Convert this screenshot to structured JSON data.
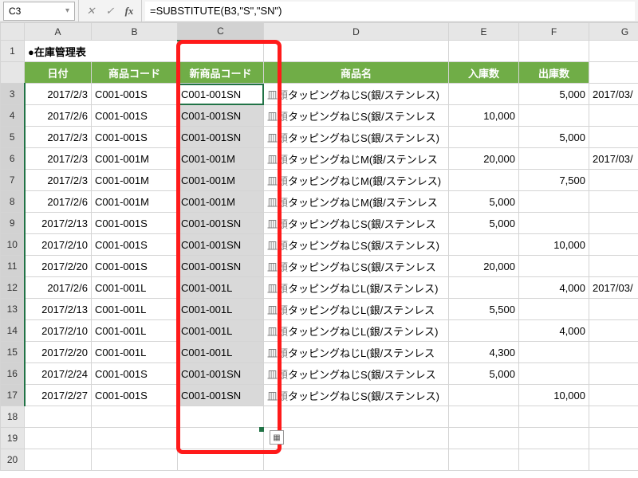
{
  "nameBox": "C3",
  "formula": "=SUBSTITUTE(B3,\"S\",\"SN\")",
  "columns": [
    "A",
    "B",
    "C",
    "D",
    "E",
    "F",
    "G"
  ],
  "selectedColumn": "C",
  "title": "●在庫管理表",
  "headers": {
    "A": "日付",
    "B": "商品コード",
    "C": "新商品コード",
    "D": "商品名",
    "E": "入庫数",
    "F": "出庫数"
  },
  "rows": [
    {
      "n": 3,
      "A": "2017/2/3",
      "B": "C001-001S",
      "C": "C001-001SN",
      "Dp": "皿頭",
      "D": "タッピングねじS(銀/ステンレス)",
      "E": "",
      "F": "5,000",
      "G": "2017/03/"
    },
    {
      "n": 4,
      "A": "2017/2/6",
      "B": "C001-001S",
      "C": "C001-001SN",
      "Dp": "皿頭",
      "D": "タッピングねじS(銀/ステンレス",
      "E": "10,000",
      "F": "",
      "G": ""
    },
    {
      "n": 5,
      "A": "2017/2/3",
      "B": "C001-001S",
      "C": "C001-001SN",
      "Dp": "皿頭",
      "D": "タッピングねじS(銀/ステンレス)",
      "E": "",
      "F": "5,000",
      "G": ""
    },
    {
      "n": 6,
      "A": "2017/2/3",
      "B": "C001-001M",
      "C": "C001-001M",
      "Dp": "皿頭",
      "D": "タッピングねじM(銀/ステンレス",
      "E": "20,000",
      "F": "",
      "G": "2017/03/"
    },
    {
      "n": 7,
      "A": "2017/2/3",
      "B": "C001-001M",
      "C": "C001-001M",
      "Dp": "皿頭",
      "D": "タッピングねじM(銀/ステンレス)",
      "E": "",
      "F": "7,500",
      "G": ""
    },
    {
      "n": 8,
      "A": "2017/2/6",
      "B": "C001-001M",
      "C": "C001-001M",
      "Dp": "皿頭",
      "D": "タッピングねじM(銀/ステンレス",
      "E": "5,000",
      "F": "",
      "G": ""
    },
    {
      "n": 9,
      "A": "2017/2/13",
      "B": "C001-001S",
      "C": "C001-001SN",
      "Dp": "皿頭",
      "D": "タッピングねじS(銀/ステンレス",
      "E": "5,000",
      "F": "",
      "G": ""
    },
    {
      "n": 10,
      "A": "2017/2/10",
      "B": "C001-001S",
      "C": "C001-001SN",
      "Dp": "皿頭",
      "D": "タッピングねじS(銀/ステンレス)",
      "E": "",
      "F": "10,000",
      "G": ""
    },
    {
      "n": 11,
      "A": "2017/2/20",
      "B": "C001-001S",
      "C": "C001-001SN",
      "Dp": "皿頭",
      "D": "タッピングねじS(銀/ステンレス",
      "E": "20,000",
      "F": "",
      "G": ""
    },
    {
      "n": 12,
      "A": "2017/2/6",
      "B": "C001-001L",
      "C": "C001-001L",
      "Dp": "皿頭",
      "D": "タッピングねじL(銀/ステンレス)",
      "E": "",
      "F": "4,000",
      "G": "2017/03/"
    },
    {
      "n": 13,
      "A": "2017/2/13",
      "B": "C001-001L",
      "C": "C001-001L",
      "Dp": "皿頭",
      "D": "タッピングねじL(銀/ステンレス",
      "E": "5,500",
      "F": "",
      "G": ""
    },
    {
      "n": 14,
      "A": "2017/2/10",
      "B": "C001-001L",
      "C": "C001-001L",
      "Dp": "皿頭",
      "D": "タッピングねじL(銀/ステンレス)",
      "E": "",
      "F": "4,000",
      "G": ""
    },
    {
      "n": 15,
      "A": "2017/2/20",
      "B": "C001-001L",
      "C": "C001-001L",
      "Dp": "皿頭",
      "D": "タッピングねじL(銀/ステンレス",
      "E": "4,300",
      "F": "",
      "G": ""
    },
    {
      "n": 16,
      "A": "2017/2/24",
      "B": "C001-001S",
      "C": "C001-001SN",
      "Dp": "皿頭",
      "D": "タッピングねじS(銀/ステンレス",
      "E": "5,000",
      "F": "",
      "G": ""
    },
    {
      "n": 17,
      "A": "2017/2/27",
      "B": "C001-001S",
      "C": "C001-001SN",
      "Dp": "皿頭",
      "D": "タッピングねじS(銀/ステンレス)",
      "E": "",
      "F": "10,000",
      "G": ""
    }
  ],
  "emptyRows": [
    18,
    19,
    20
  ],
  "activeCellRow": 3,
  "selectionRows": {
    "from": 3,
    "to": 17
  }
}
